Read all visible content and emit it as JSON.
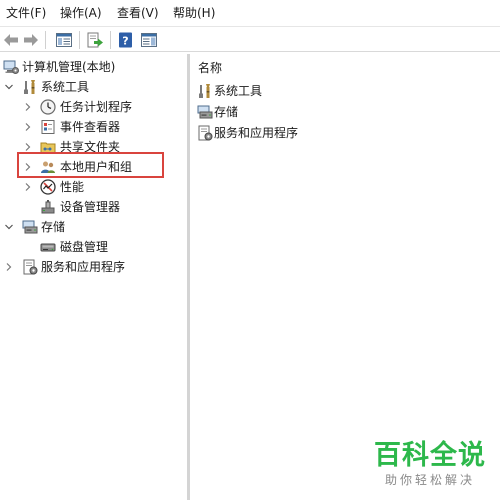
{
  "menubar": {
    "file": "文件(F)",
    "action": "操作(A)",
    "view": "查看(V)",
    "help": "帮助(H)"
  },
  "toolbar": {
    "buttons": [
      "back-arrow-icon",
      "forward-arrow-icon",
      "show-hide-tree-icon",
      "export-list-icon",
      "help-icon",
      "action-pane-icon"
    ]
  },
  "tree": {
    "root": "计算机管理(本地)",
    "system_tools": "系统工具",
    "task_scheduler": "任务计划程序",
    "event_viewer": "事件查看器",
    "shared_folders": "共享文件夹",
    "local_users_groups": "本地用户和组",
    "performance": "性能",
    "device_manager": "设备管理器",
    "storage": "存储",
    "disk_management": "磁盘管理",
    "services_apps": "服务和应用程序"
  },
  "list": {
    "column_name": "名称",
    "items": [
      "系统工具",
      "存储",
      "服务和应用程序"
    ]
  },
  "watermark": {
    "title": "百科全说",
    "subtitle": "助你轻松解决"
  },
  "colors": {
    "highlight_border": "#d9443e",
    "watermark_green": "#2db84b"
  }
}
